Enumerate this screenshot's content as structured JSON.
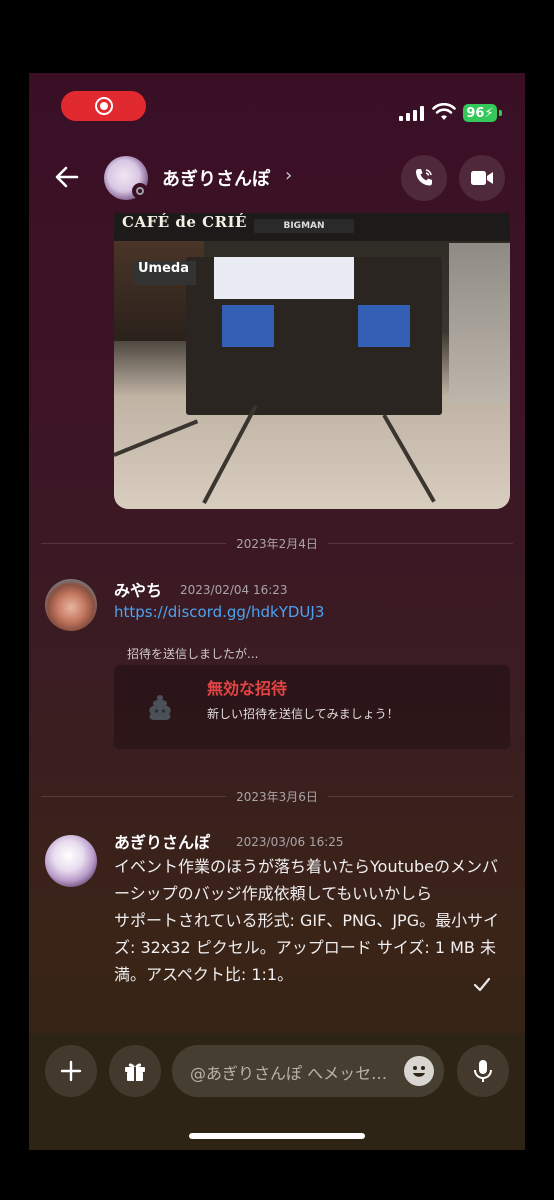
{
  "status_bar": {
    "battery": "96"
  },
  "header": {
    "title": "あぎりさんぽ",
    "chevron": "›"
  },
  "photo": {
    "sign_cafe": "CAFÉ de CRIÉ",
    "sign_bigman": "BIGMAN",
    "sign_umeda": "Umeda"
  },
  "separators": [
    "2023年2月4日",
    "2023年3月6日"
  ],
  "messages": [
    {
      "author": "みやち",
      "timestamp": "2023/02/04 16:23",
      "link": "https://discord.gg/hdkYDUJ3",
      "invite": {
        "label": "招待を送信しましたが...",
        "title": "無効な招待",
        "subtitle": "新しい招待を送信してみましょう！"
      }
    },
    {
      "author": "あぎりさんぽ",
      "timestamp": "2023/03/06 16:25",
      "lines": [
        "イベント作業のほうが落ち着いたらYoutubeのメンバーシップのバッジ作成依頼してもいいかしら",
        "サポートされている形式: GIF、PNG、JPG。最小サイズ: 32x32 ピクセル。アップロード サイズ: 1 MB 未満。アスペクト比: 1:1。"
      ]
    }
  ],
  "composer": {
    "placeholder": "@あぎりさんぽ へメッセージを送信"
  },
  "icons": [
    "record-icon",
    "signal-icon",
    "wifi-icon",
    "battery-icon",
    "back-arrow-icon",
    "phone-call-icon",
    "video-camera-icon",
    "poop-icon",
    "checkmark-icon",
    "plus-icon",
    "gift-icon",
    "emoji-icon",
    "microphone-icon"
  ],
  "colors": {
    "accent_link": "#4ba3f0",
    "error": "#e54545",
    "battery": "#34c759",
    "record": "#e02a2f"
  }
}
